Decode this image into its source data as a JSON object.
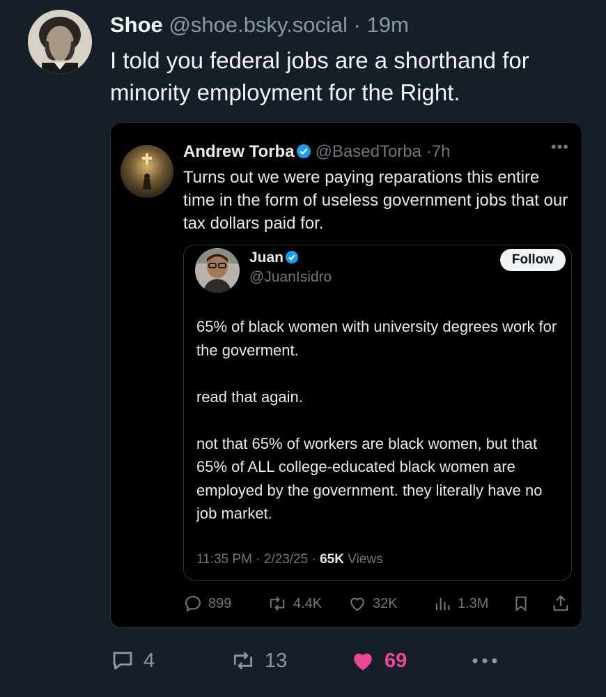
{
  "post": {
    "author_name": "Shoe",
    "author_handle": "@shoe.bsky.social",
    "separator": "·",
    "time": "19m",
    "text": "I told you federal jobs are a shorthand for minority employment for the Right.",
    "actions": {
      "replies": "4",
      "reposts": "13",
      "likes": "69"
    }
  },
  "quoted": {
    "author_name": "Andrew Torba",
    "author_handle": "@BasedTorba",
    "separator": "·",
    "time": "7h",
    "text": "Turns out we were paying reparations this entire time in the form of useless government jobs that our tax dollars paid for.",
    "inner": {
      "author_name": "Juan",
      "author_handle": "@JuanIsidro",
      "follow_label": "Follow",
      "paragraphs": [
        "65% of black women with university degrees work for the goverment.",
        "read that again.",
        "not that 65% of workers are black women, but that 65% of ALL college-educated black women are employed by the government. they literally have no job market."
      ],
      "time": "11:35 PM",
      "date": "2/23/25",
      "views_count": "65K",
      "views_label": "Views"
    },
    "actions": {
      "replies": "899",
      "reposts": "4.4K",
      "likes": "32K",
      "views": "1.3M"
    }
  },
  "colors": {
    "background": "#161e27",
    "verified": "#1d9bf0",
    "like_active": "#ec4899",
    "muted": "#8b98a9"
  }
}
